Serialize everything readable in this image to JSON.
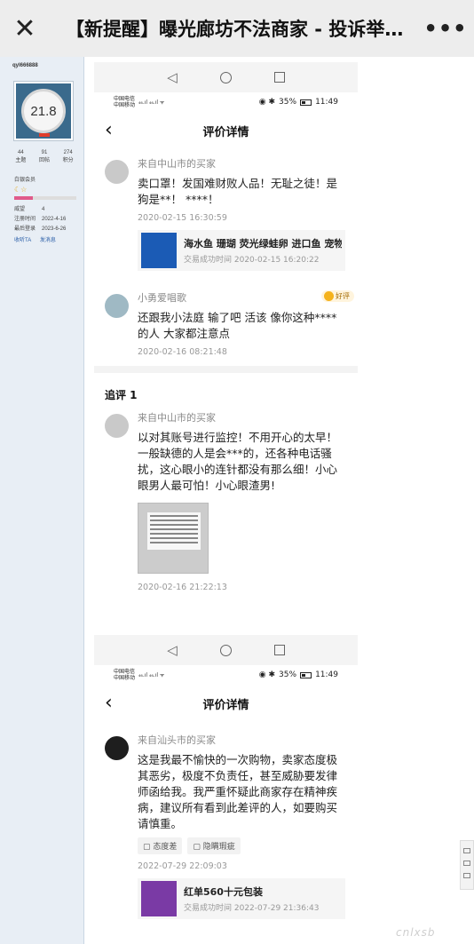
{
  "topbar": {
    "title": "【新提醒】曝光廊坊不法商家 - 投诉举报中心",
    "more": "•••"
  },
  "forum_sidebar": {
    "username": "qyl666888",
    "avatar_text": "21.8",
    "stats": [
      {
        "value": "44",
        "label": "主题"
      },
      {
        "value": "91",
        "label": "回帖"
      },
      {
        "value": "274",
        "label": "积分"
      }
    ],
    "group": "白银会员",
    "rows": [
      {
        "k": "威望",
        "v": "4"
      },
      {
        "k": "注册时间",
        "v": "2022-4-16"
      },
      {
        "k": "最后登录",
        "v": "2023-6-26"
      }
    ],
    "actions": [
      "收听TA",
      "发消息"
    ]
  },
  "shot1": {
    "status_carrier1": "中国电信",
    "status_carrier2": "中国移动",
    "battery": "35%",
    "time": "11:49",
    "header_title": "评价详情",
    "reviews": [
      {
        "name": "来自中山市的买家",
        "text": "卖口罩！发国难财败人品！无耻之徒！是狗是**！ ****！",
        "time": "2020-02-15 16:30:59",
        "product_name": "海水鱼 珊瑚 荧光绿蛙卵 进口鱼 宠物",
        "product_deal": "交易成功时间 2020-02-15 16:20:22"
      },
      {
        "name": "小勇爱唱歌",
        "badge": "好评",
        "text": "还跟我小法庭 输了吧 活该 像你这种****的人 大家都注意点",
        "time": "2020-02-16 08:21:48"
      }
    ],
    "followup_title": "追评 1",
    "followup": {
      "name": "来自中山市的买家",
      "text": "以对其账号进行监控！不用开心的太早！一般缺德的人是会***的，还各种电话骚扰，这心眼小的连针都没有那么细！小心眼男人最可怕！小心眼渣男!",
      "time": "2020-02-16 21:22:13"
    }
  },
  "shot2": {
    "status_carrier1": "中国电信",
    "status_carrier2": "中国移动",
    "battery": "35%",
    "time": "11:49",
    "header_title": "评价详情",
    "review": {
      "name": "来自汕头市的买家",
      "text": "这是我最不愉快的一次购物，卖家态度极其恶劣，极度不负责任，甚至威胁要发律师函给我。我严重怀疑此商家存在精神疾病，建议所有看到此差评的人，如要购买请慎重。",
      "tags": [
        "态度差",
        "隐瞒瑕疵"
      ],
      "time": "2022-07-29 22:09:03",
      "product_name": "红单560十元包装",
      "product_deal": "交易成功时间 2022-07-29 21:36:43"
    }
  },
  "watermark": "cnlxsb",
  "colors": {
    "accent": "#e03c2b",
    "product_thumb": "#1b5bb5",
    "coin": "#f5b21c"
  }
}
